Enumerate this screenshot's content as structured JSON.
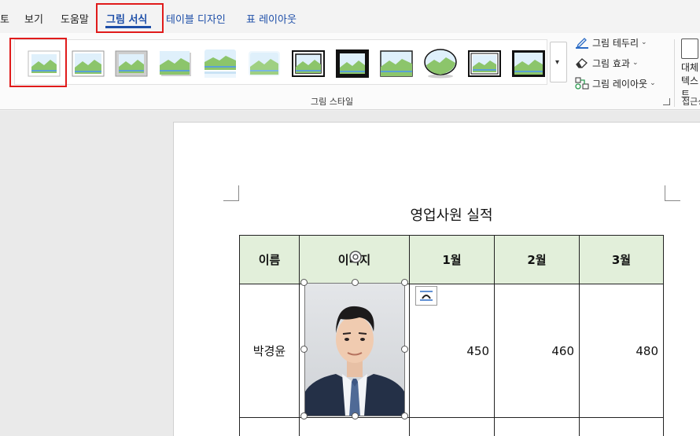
{
  "tabs": [
    {
      "label": "토"
    },
    {
      "label": "보기"
    },
    {
      "label": "도움말"
    },
    {
      "label": "그림 서식"
    },
    {
      "label": "테이블 디자인"
    },
    {
      "label": "표 레이아웃"
    }
  ],
  "ribbon": {
    "picture_styles": {
      "group_label": "그림 스타일",
      "items": [
        {
          "icon": "picture-style-simple-frame-white"
        },
        {
          "icon": "picture-style-beveled-matte-white"
        },
        {
          "icon": "picture-style-metal-frame"
        },
        {
          "icon": "picture-style-drop-shadow-rectangle"
        },
        {
          "icon": "picture-style-reflected-rounded-rectangle"
        },
        {
          "icon": "picture-style-soft-edge-rectangle"
        },
        {
          "icon": "picture-style-double-frame-black"
        },
        {
          "icon": "picture-style-thick-matte-black"
        },
        {
          "icon": "picture-style-simple-frame-black"
        },
        {
          "icon": "picture-style-oval"
        },
        {
          "icon": "picture-style-compound-frame-black"
        },
        {
          "icon": "picture-style-center-shadow-rectangle"
        }
      ],
      "more_icon": "chevron-down-icon"
    },
    "picture_border": {
      "label": "그림 테두리",
      "icon": "pen-border-icon"
    },
    "picture_effects": {
      "label": "그림 효과",
      "icon": "eraser-effects-icon"
    },
    "picture_layout": {
      "label": "그림 레이아웃",
      "icon": "smartart-layout-icon"
    },
    "alt_text": {
      "line1": "대체",
      "line2": "텍스트",
      "group_label": "접근성"
    }
  },
  "document": {
    "title": "영업사원 실적",
    "table": {
      "headers": [
        "이름",
        "이미지",
        "1월",
        "2월",
        "3월"
      ],
      "rows": [
        {
          "name": "박경윤",
          "m1": "450",
          "m2": "460",
          "m3": "480"
        }
      ]
    }
  },
  "colors": {
    "accent": "#1d4ea8",
    "highlight": "#e01b1b",
    "header_fill": "#e2efda"
  }
}
